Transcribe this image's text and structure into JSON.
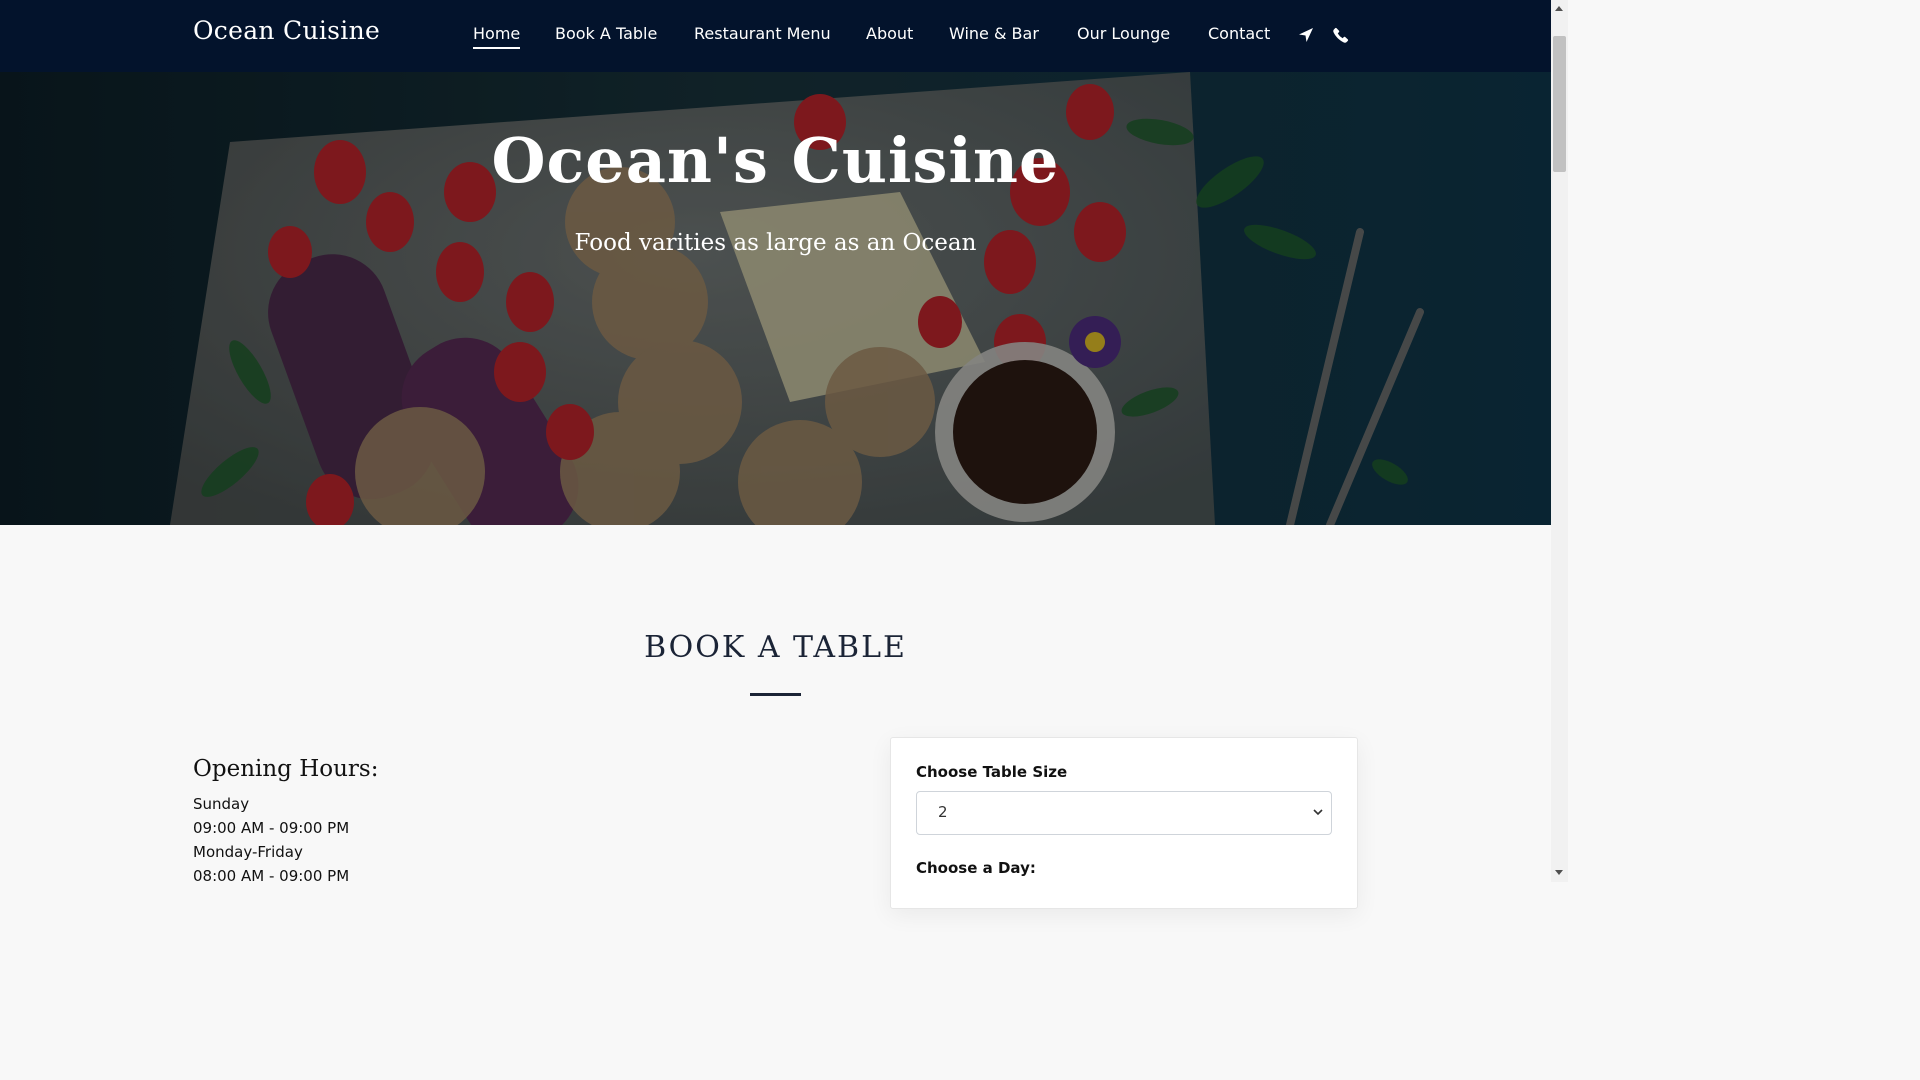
{
  "nav": {
    "brand": "Ocean Cuisine",
    "links": [
      "Home",
      "Book A Table",
      "Restaurant Menu",
      "About",
      "Wine & Bar",
      "Our Lounge",
      "Contact"
    ],
    "icons": [
      "location-arrow-icon",
      "phone-icon"
    ]
  },
  "hero": {
    "title": "Ocean's Cuisine",
    "subtitle": "Food varities as large as an Ocean"
  },
  "booking": {
    "heading": "BOOK A TABLE",
    "hours_title": "Opening Hours:",
    "hours": [
      {
        "day": "Sunday",
        "time": "09:00 AM - 09:00 PM"
      },
      {
        "day": "Monday-Friday",
        "time": "08:00 AM - 09:00 PM"
      }
    ],
    "form": {
      "table_size_label": "Choose Table Size",
      "table_size_value": "2",
      "day_label": "Choose a Day:"
    }
  },
  "colors": {
    "nav_bg": "#03132c",
    "heading": "#1b2436",
    "page_bg": "#f8f8f8"
  }
}
